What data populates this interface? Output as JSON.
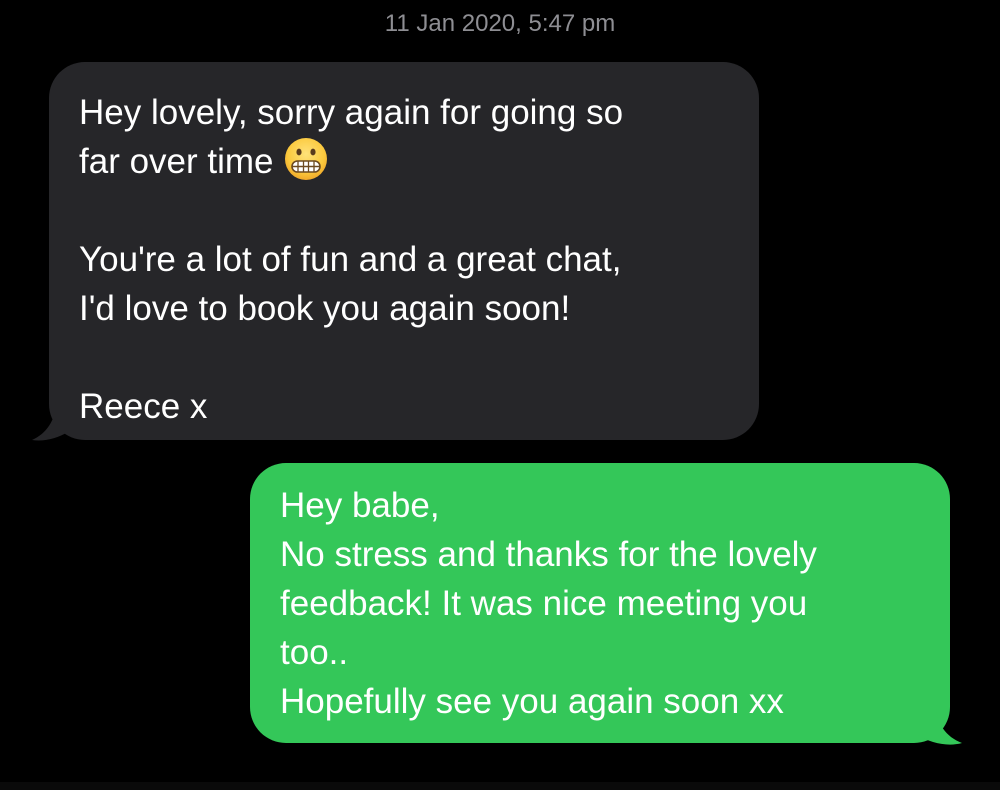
{
  "thread": {
    "timestamp": "11 Jan 2020, 5:47 pm"
  },
  "messages": [
    {
      "direction": "received",
      "bubble_color": "#262629",
      "lines": [
        "Hey lovely, sorry again for going so",
        "far over time",
        "",
        "You're a lot of fun and a great chat,",
        "I'd love to book you again soon!",
        "",
        "Reece x"
      ],
      "emoji": "grimacing-face-emoji"
    },
    {
      "direction": "sent",
      "bubble_color": "#34c759",
      "lines": [
        "Hey babe,",
        "No stress and thanks for the lovely",
        "feedback! It was nice meeting you",
        "too..",
        "Hopefully see you again soon xx"
      ]
    }
  ],
  "colors": {
    "background": "#000000",
    "timestamp_text": "#8e8e93",
    "message_text": "#ffffff"
  }
}
